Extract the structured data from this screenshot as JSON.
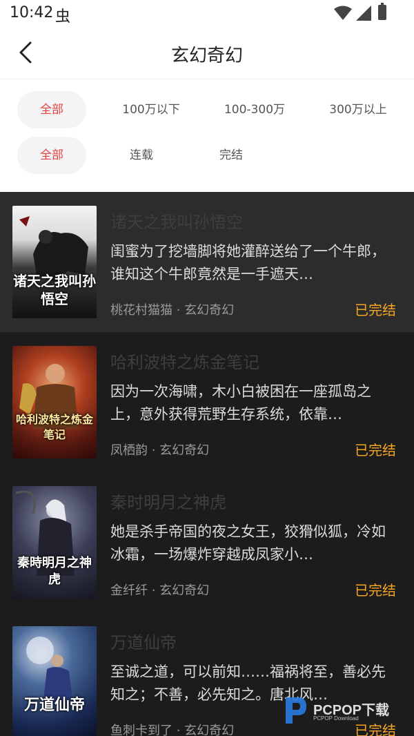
{
  "status_bar": {
    "time": "10:42",
    "bug_glyph": "虫",
    "icons": [
      "wifi-icon",
      "signal-icon",
      "battery-icon"
    ]
  },
  "header": {
    "title": "玄幻奇幻",
    "back_icon": "chevron-left-icon"
  },
  "filters": {
    "word_count": [
      {
        "label": "全部",
        "active": true
      },
      {
        "label": "100万以下",
        "active": false
      },
      {
        "label": "100-300万",
        "active": false
      },
      {
        "label": "300万以上",
        "active": false
      }
    ],
    "status": [
      {
        "label": "全部",
        "active": true
      },
      {
        "label": "连载",
        "active": false
      },
      {
        "label": "完结",
        "active": false
      }
    ]
  },
  "books": [
    {
      "title": "诸天之我叫孙悟空",
      "description": "闺蜜为了挖墙脚将她灌醉送给了一个牛郎，谁知这个牛郎竟然是一手遮天…",
      "author": "桃花村猫猫",
      "category": "玄幻奇幻",
      "status": "已完结",
      "cover_text": "诸天之我叫孙悟空"
    },
    {
      "title": "哈利波特之炼金笔记",
      "description": "因为一次海啸，木小白被困在一座孤岛之上，意外获得荒野生存系统，依靠…",
      "author": "凤栖韵",
      "category": "玄幻奇幻",
      "status": "已完结",
      "cover_text": "哈利波特之炼金笔记"
    },
    {
      "title": "秦时明月之神虎",
      "description": "她是杀手帝国的夜之女王，狡猾似狐，冷如冰霜，一场爆炸穿越成凤家小…",
      "author": "金纤纤",
      "category": "玄幻奇幻",
      "status": "已完结",
      "cover_text": "秦時明月之神虎"
    },
    {
      "title": "万道仙帝",
      "description": "至诚之道，可以前知……福祸将至，善必先知之；不善，必先知之。唐北风…",
      "author": "鱼刺卡到了",
      "category": "玄幻奇幻",
      "status": "已完结",
      "cover_text": "万道仙帝"
    }
  ],
  "meta_separator": " · ",
  "watermark": {
    "text": "PCPOP下载",
    "sub": "PCPOP Download"
  },
  "colors": {
    "accent": "#e5423e",
    "status_done": "#f5a623",
    "list_bg": "#1c1c1c",
    "highlight_row": "#2c2c2c"
  }
}
